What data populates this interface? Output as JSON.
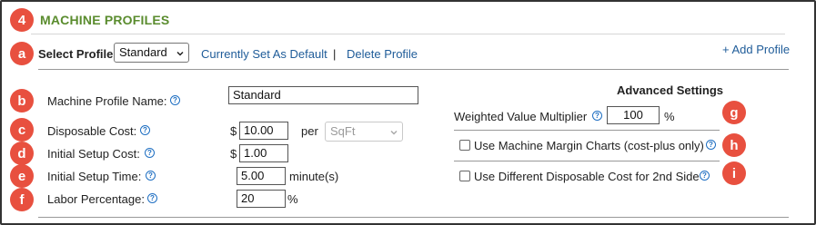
{
  "title": "MACHINE PROFILES",
  "badges": {
    "n4": "4",
    "a": "a",
    "b": "b",
    "c": "c",
    "d": "d",
    "e": "e",
    "f": "f",
    "g": "g",
    "h": "h",
    "i": "i"
  },
  "profile_bar": {
    "select_label": "Select Profile",
    "select_value": "Standard",
    "default_link": "Currently Set As Default",
    "separator": "|",
    "delete_link": "Delete Profile",
    "add_link": "+ Add Profile"
  },
  "form": {
    "name_label": "Machine Profile Name:",
    "name_value": "Standard",
    "disposable_label": "Disposable Cost:",
    "currency": "$",
    "disposable_value": "10.00",
    "per_label": "per",
    "unit_value": "SqFt",
    "setup_cost_label": "Initial Setup Cost:",
    "setup_cost_value": "1.00",
    "setup_time_label": "Initial Setup Time:",
    "setup_time_value": "5.00",
    "setup_time_unit": "minute(s)",
    "labor_label": "Labor Percentage:",
    "labor_value": "20",
    "percent": "%"
  },
  "advanced": {
    "heading": "Advanced Settings",
    "multiplier_label": "Weighted Value Multiplier",
    "multiplier_value": "100",
    "percent": "%",
    "margin_charts_label": "Use Machine Margin Charts (cost-plus only)",
    "margin_charts_checked": false,
    "diff_cost_label": "Use Different Disposable Cost for 2nd Side",
    "diff_cost_checked": false
  },
  "icons": {
    "help": "?"
  },
  "colors": {
    "badge": "#e8503f",
    "title": "#5a8c2e",
    "link": "#1f5c99",
    "help": "#1f6fc2"
  }
}
